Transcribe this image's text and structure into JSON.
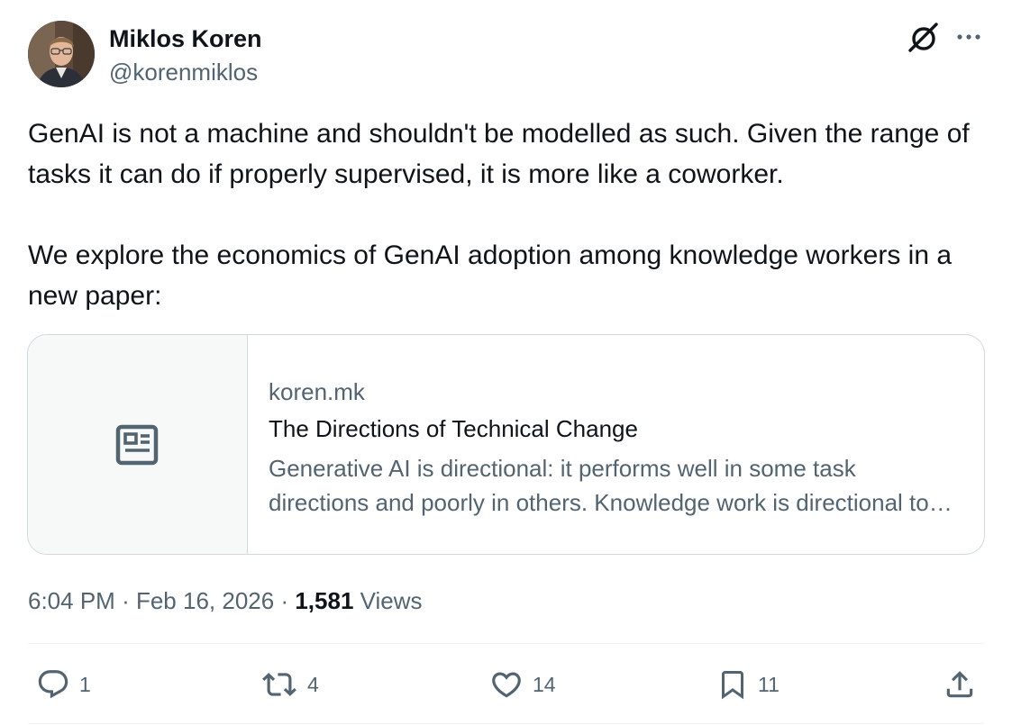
{
  "author": {
    "name": "Miklos Koren",
    "handle": "@korenmiklos"
  },
  "tweet": {
    "paragraphs": [
      "GenAI is not a machine and shouldn't be modelled as such. Given the range of tasks it can do if properly supervised, it is more like a coworker.",
      "We explore the economics of GenAI adoption among knowledge workers in a new paper:"
    ]
  },
  "link_card": {
    "domain": "koren.mk",
    "title": "The Directions of Technical Change",
    "description": "Generative AI is directional: it performs well in some task directions and poorly in others. Knowledge work is directional too — each occupation demands a specific mix of tasks.",
    "icon": "article-icon"
  },
  "meta": {
    "time": "6:04 PM",
    "separator": "·",
    "date": "Feb 16, 2026",
    "views_count": "1,581",
    "views_label": "Views"
  },
  "actions": {
    "reply": {
      "icon": "reply-icon",
      "count": "1"
    },
    "retweet": {
      "icon": "retweet-icon",
      "count": "4"
    },
    "like": {
      "icon": "heart-icon",
      "count": "14"
    },
    "bookmark": {
      "icon": "bookmark-icon",
      "count": "11"
    },
    "share": {
      "icon": "share-icon"
    }
  },
  "header_icons": {
    "grok": "grok-icon",
    "more": "more-icon"
  },
  "colors": {
    "text_primary": "#0f1419",
    "text_secondary": "#536471",
    "border": "#cfd9de",
    "card_thumb_bg": "#f7f9f9"
  }
}
